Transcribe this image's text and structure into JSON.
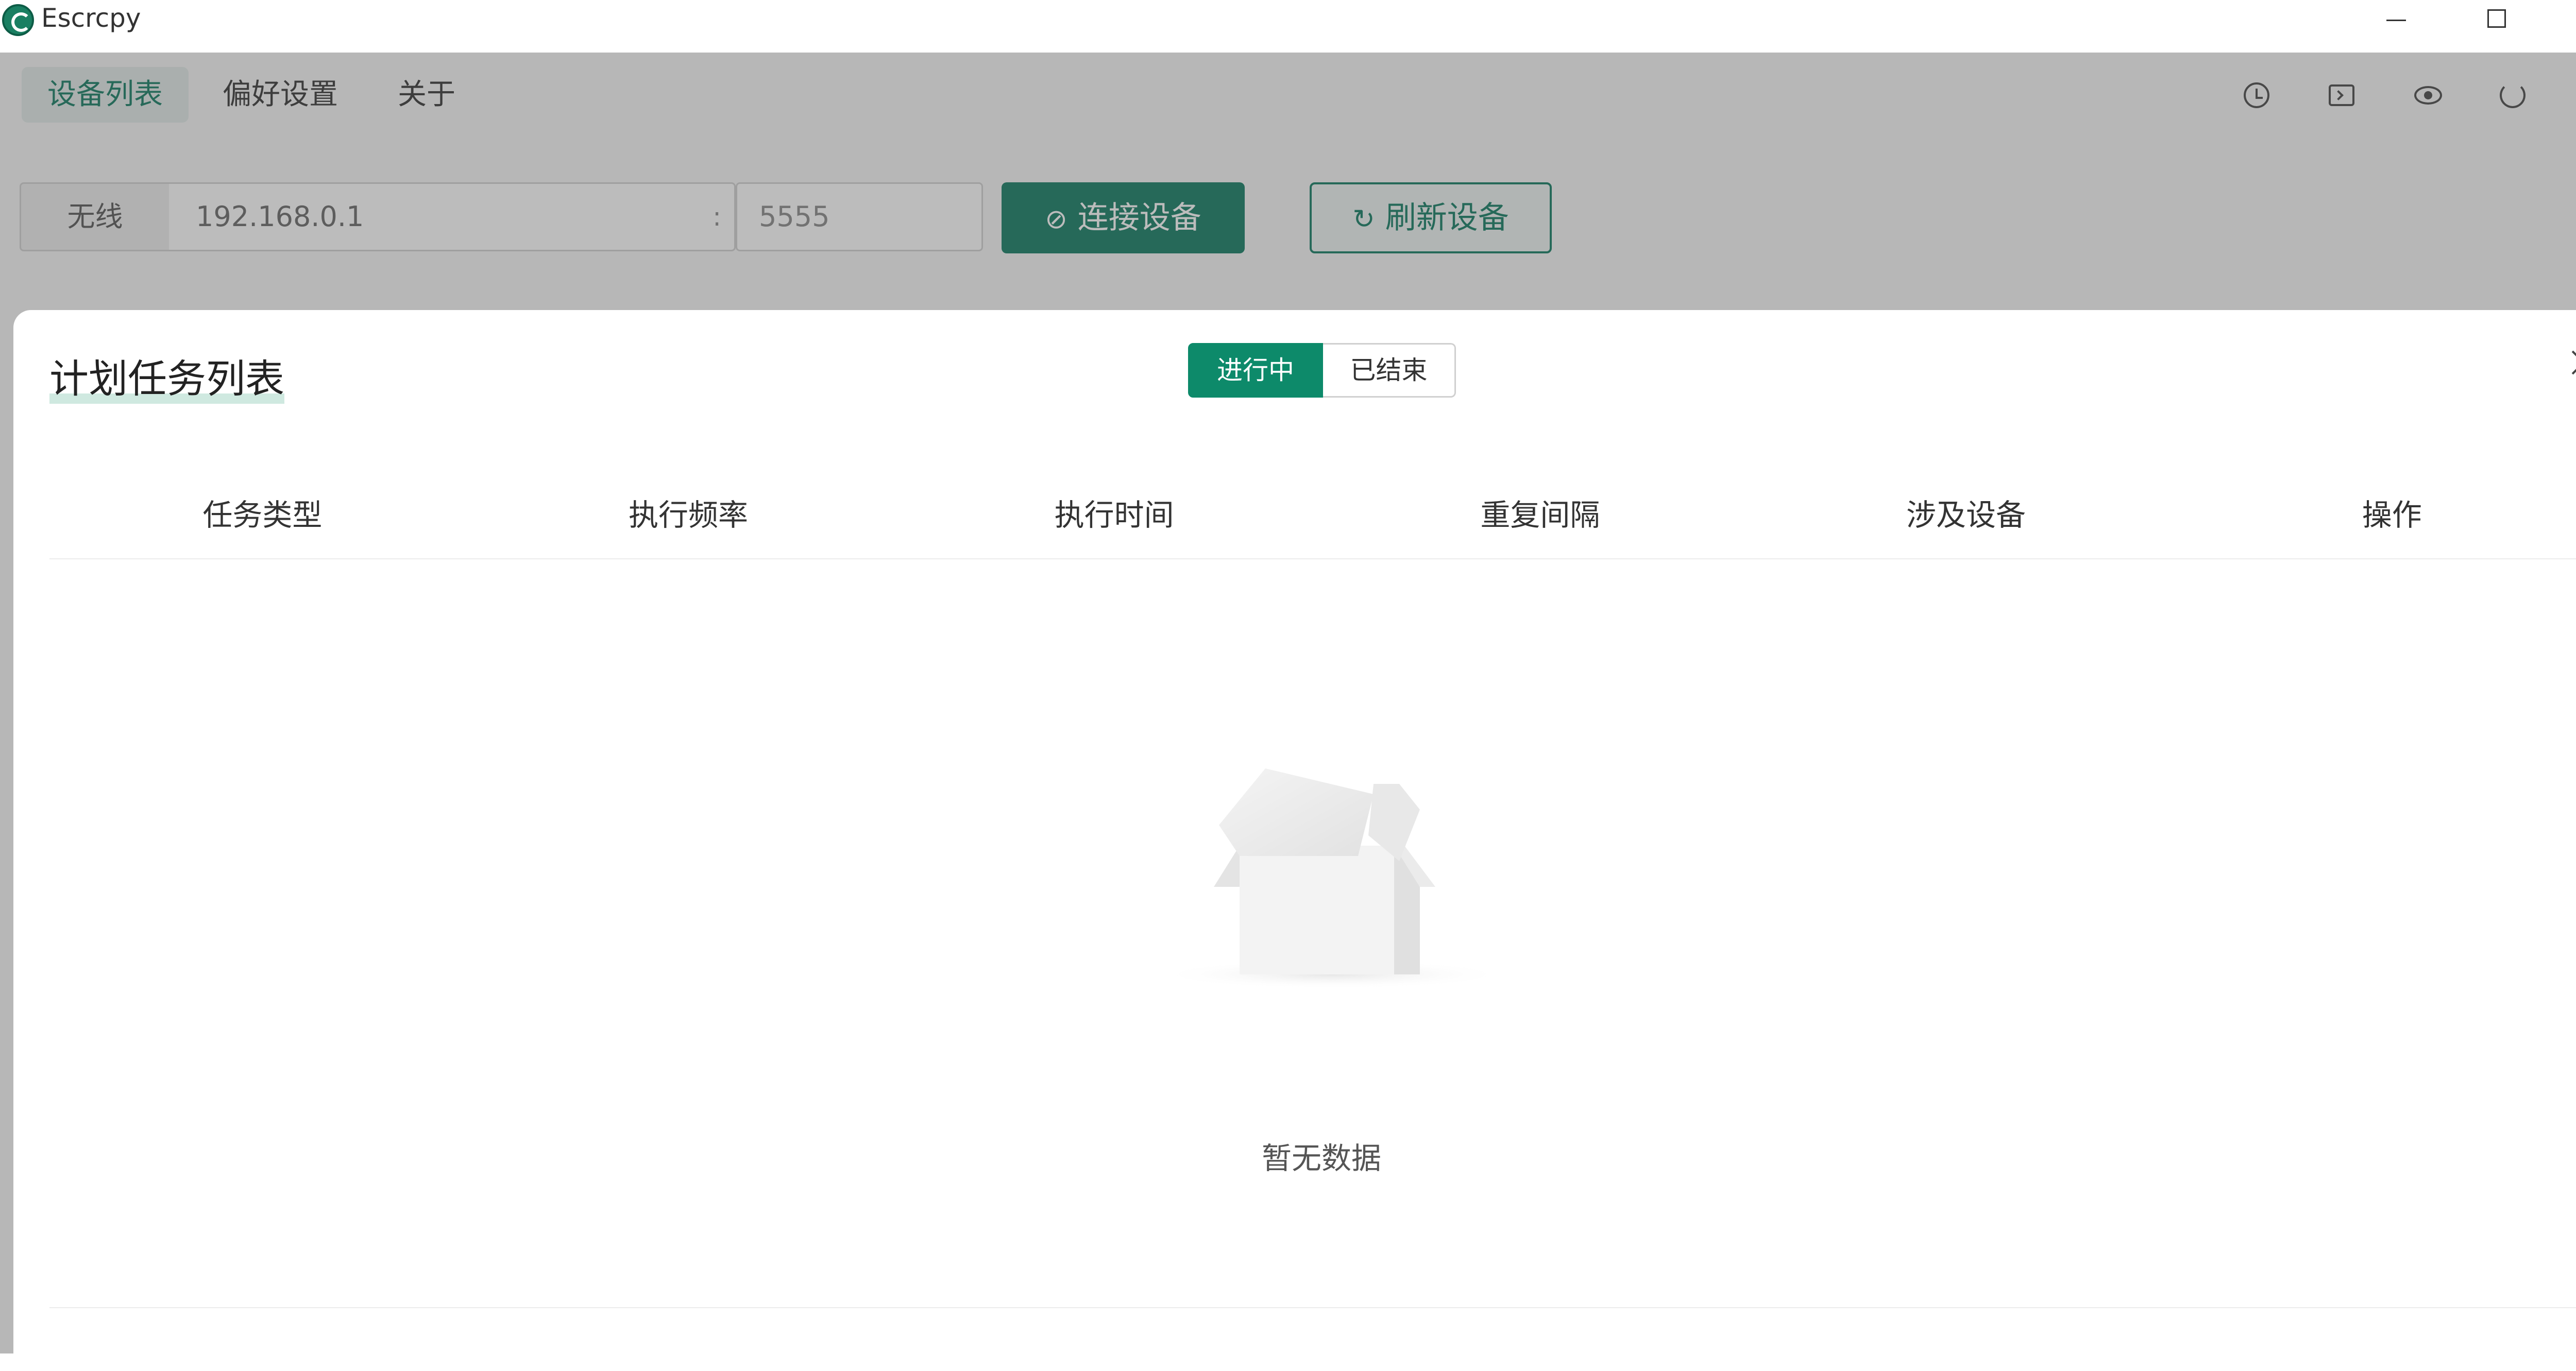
{
  "window": {
    "title": "Escrcpy"
  },
  "nav": {
    "tabs": [
      {
        "label": "设备列表",
        "active": true
      },
      {
        "label": "偏好设置",
        "active": false
      },
      {
        "label": "关于",
        "active": false
      }
    ],
    "tool_icons": [
      "clock-icon",
      "terminal-icon",
      "eye-icon",
      "refresh-icon",
      "circle-icon"
    ]
  },
  "connect_bar": {
    "mode_label": "无线",
    "ip_placeholder": "192.168.0.1",
    "separator": ":",
    "port_placeholder": "5555",
    "connect_label": "连接设备",
    "refresh_label": "刷新设备"
  },
  "dialog": {
    "title": "计划任务列表",
    "segments": [
      {
        "label": "进行中",
        "active": true
      },
      {
        "label": "已结束",
        "active": false
      }
    ],
    "columns": [
      "任务类型",
      "执行频率",
      "执行时间",
      "重复间隔",
      "涉及设备",
      "操作"
    ],
    "empty_text": "暂无数据"
  },
  "colors": {
    "accent": "#0d7a60",
    "segment_active": "#0d8a6a"
  }
}
